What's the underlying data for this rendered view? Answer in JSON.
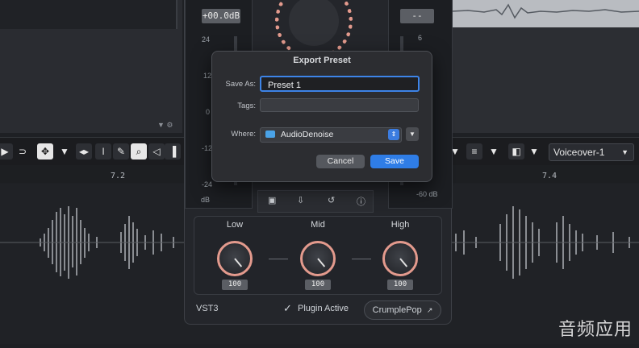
{
  "background": {
    "timeline_ticks": [
      "7.2",
      "7.4"
    ],
    "track_select": "Voiceover-1"
  },
  "plugin": {
    "input_readout": "+00.0dB",
    "output_readout": "--",
    "left_scale": [
      "24",
      "12",
      "0",
      "-12",
      "-24",
      "dB"
    ],
    "right_scale_top": "6",
    "right_scale_bottom": "-60 dB",
    "bands": [
      {
        "label": "Low",
        "value": "100"
      },
      {
        "label": "Mid",
        "value": "100"
      },
      {
        "label": "High",
        "value": "100"
      }
    ],
    "format_label": "VST3",
    "active_label": "Plugin Active",
    "brand_label": "CrumplePop"
  },
  "dialog": {
    "title": "Export Preset",
    "save_as_label": "Save As:",
    "save_as_value": "Preset 1",
    "tags_label": "Tags:",
    "tags_value": "",
    "where_label": "Where:",
    "where_value": "AudioDenoise",
    "cancel_label": "Cancel",
    "save_label": "Save"
  },
  "watermark": "音频应用",
  "colors": {
    "accent_blue": "#2f7de6",
    "knob_ring": "#e39a8d"
  }
}
